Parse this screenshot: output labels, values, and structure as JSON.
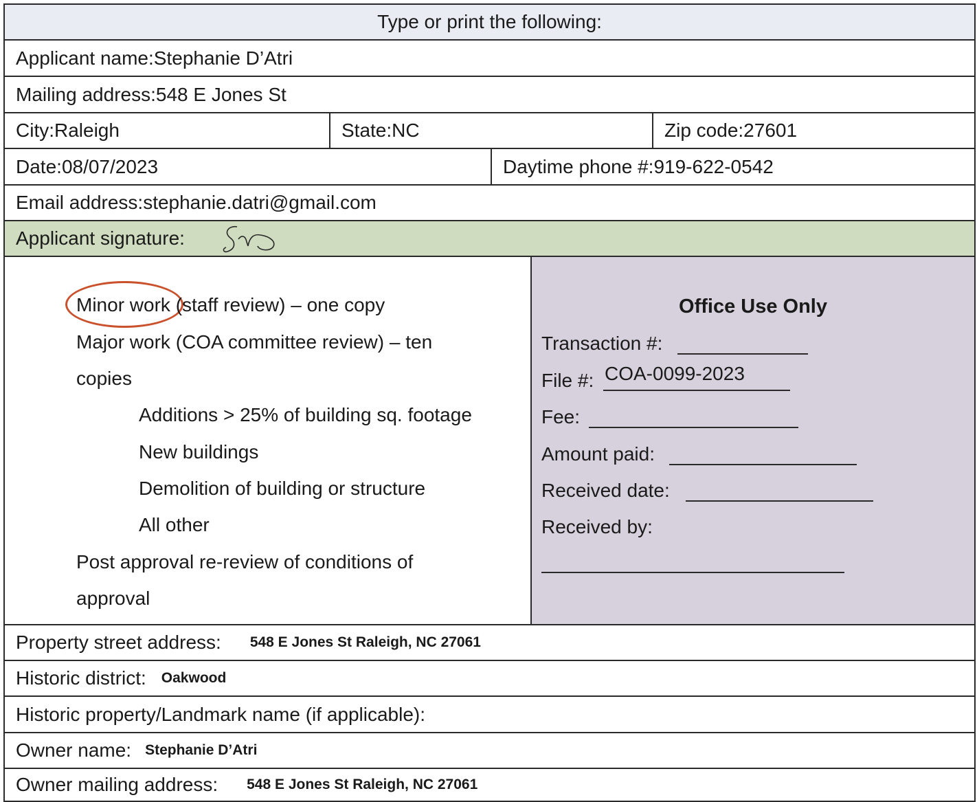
{
  "header": {
    "title": "Type or print the following:"
  },
  "applicant": {
    "name_label": "Applicant name:",
    "name_value": "Stephanie D’Atri",
    "mailing_label": "Mailing address:",
    "mailing_value": "548 E Jones St",
    "city_label": "City:",
    "city_value": "Raleigh",
    "state_label": "State:",
    "state_value": "NC",
    "zip_label": "Zip code:",
    "zip_value": "27601",
    "date_label": "Date:",
    "date_value": "08/07/2023",
    "phone_label": "Daytime phone #:",
    "phone_value": "919-622-0542",
    "email_label": "Email address:",
    "email_value": "stephanie.datri@gmail.com",
    "signature_label": "Applicant signature:",
    "signature_initials": "SD"
  },
  "work_types": {
    "minor_a": "Minor work",
    "minor_b": " (staff review) – one copy",
    "major_line1": "Major work (COA committee review) – ten",
    "major_line2": "copies",
    "additions": "Additions > 25% of building sq. footage",
    "new_buildings": "New buildings",
    "demolition": "Demolition of building or structure",
    "all_other": "All other",
    "post_line1": "Post approval re-review of conditions of",
    "post_line2": "approval",
    "selected": "Minor work"
  },
  "office": {
    "title": "Office Use Only",
    "transaction_label": "Transaction #:",
    "file_label": "File #:",
    "file_value": "COA-0099-2023",
    "fee_label": "Fee:",
    "amount_label": "Amount paid:",
    "received_date_label": "Received date:",
    "received_by_label": "Received by:"
  },
  "property": {
    "street_label": "Property street address:",
    "street_value": "548 E Jones St Raleigh, NC 27061",
    "district_label": "Historic district:",
    "district_value": "Oakwood",
    "landmark_label": "Historic property/Landmark name (if applicable):",
    "owner_label": "Owner name:",
    "owner_value": "Stephanie D’Atri",
    "owner_mailing_label": "Owner mailing address:",
    "owner_mailing_value": "548 E Jones St Raleigh, NC 27061"
  },
  "colors": {
    "signature_band": "#cfdcc0",
    "office_panel": "#d6d1dc",
    "circle": "#c9512c",
    "header_band": "#e9ecf3"
  }
}
